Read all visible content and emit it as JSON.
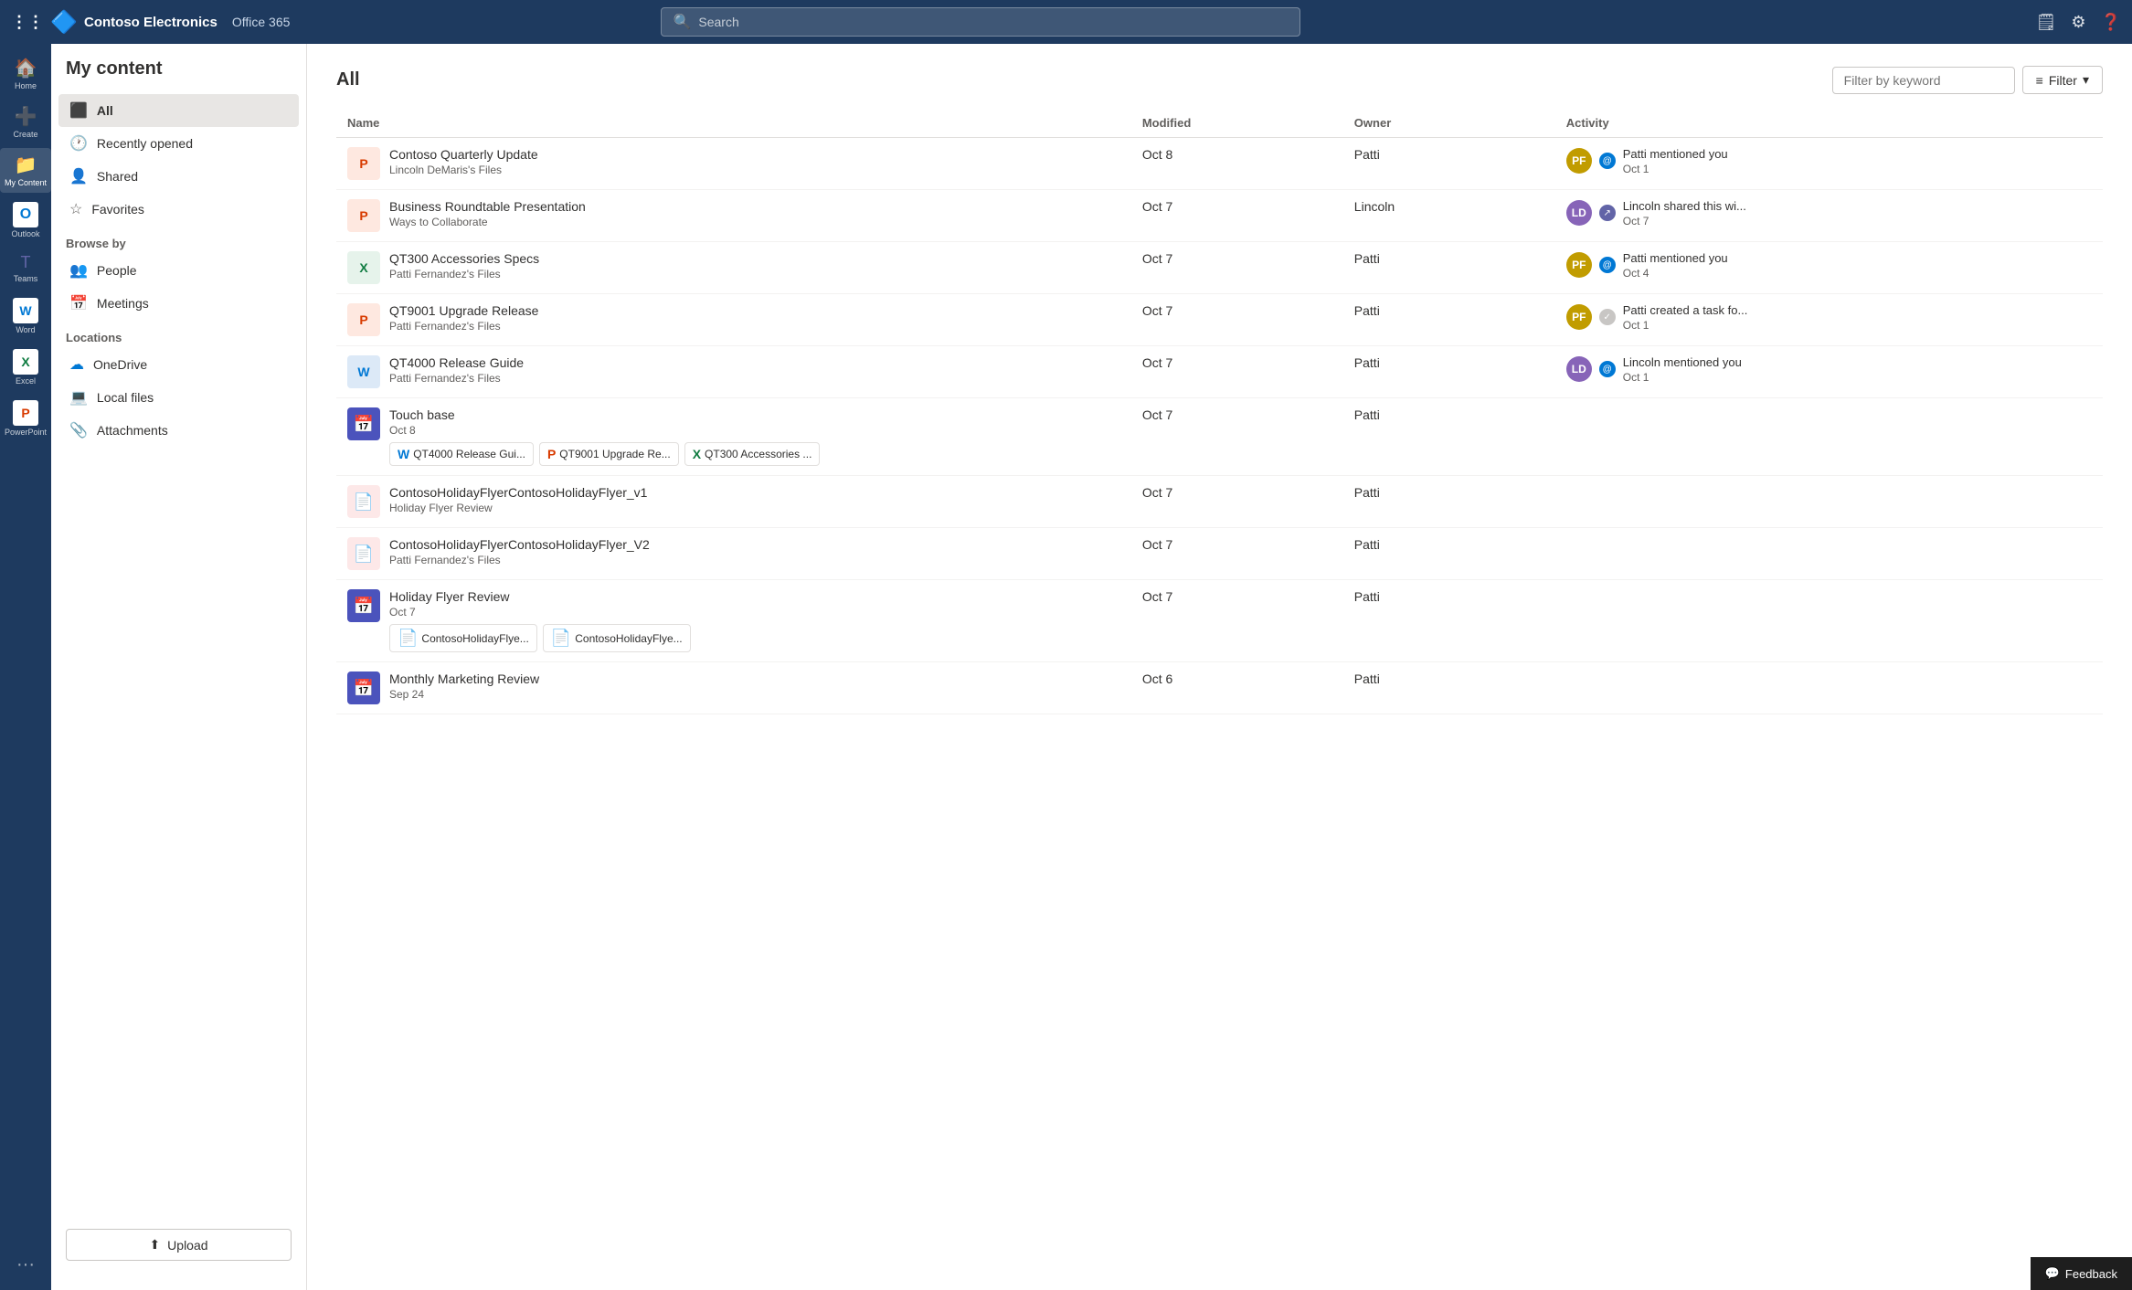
{
  "topnav": {
    "logo_icon": "🔷",
    "company_name": "Contoso Electronics",
    "app_name": "Office 365",
    "search_placeholder": "Search"
  },
  "left_rail": {
    "items": [
      {
        "id": "home",
        "icon": "🏠",
        "label": "Home"
      },
      {
        "id": "create",
        "icon": "➕",
        "label": "Create"
      },
      {
        "id": "mycontent",
        "icon": "📁",
        "label": "My Content",
        "active": true
      },
      {
        "id": "outlook",
        "icon": "📧",
        "label": "Outlook"
      },
      {
        "id": "teams",
        "icon": "👥",
        "label": "Teams"
      },
      {
        "id": "word",
        "icon": "W",
        "label": "Word"
      },
      {
        "id": "excel",
        "icon": "X",
        "label": "Excel"
      },
      {
        "id": "powerpoint",
        "icon": "P",
        "label": "PowerPoint"
      }
    ],
    "more_label": "..."
  },
  "sidebar": {
    "title": "My content",
    "nav_items": [
      {
        "id": "all",
        "icon": "⬛",
        "label": "All",
        "active": true
      },
      {
        "id": "recently-opened",
        "icon": "🕐",
        "label": "Recently opened"
      },
      {
        "id": "shared",
        "icon": "👤",
        "label": "Shared"
      },
      {
        "id": "favorites",
        "icon": "☆",
        "label": "Favorites"
      }
    ],
    "browse_section": "Browse by",
    "browse_items": [
      {
        "id": "people",
        "icon": "👥",
        "label": "People"
      },
      {
        "id": "meetings",
        "icon": "📅",
        "label": "Meetings"
      }
    ],
    "locations_section": "Locations",
    "locations": [
      {
        "id": "onedrive",
        "icon": "☁",
        "label": "OneDrive"
      },
      {
        "id": "local-files",
        "icon": "💻",
        "label": "Local files"
      },
      {
        "id": "attachments",
        "icon": "📎",
        "label": "Attachments"
      }
    ],
    "upload_label": "Upload",
    "upload_icon": "⬆"
  },
  "content": {
    "title": "All",
    "filter_placeholder": "Filter by keyword",
    "filter_label": "Filter",
    "columns": {
      "name": "Name",
      "modified": "Modified",
      "owner": "Owner",
      "activity": "Activity"
    },
    "files": [
      {
        "id": 1,
        "icon_type": "ppt",
        "icon_char": "P",
        "name": "Contoso Quarterly Update",
        "subtitle": "Lincoln DeMaris's Files",
        "modified": "Oct 8",
        "owner": "Patti",
        "activity_user": "Patti",
        "activity_avatar_class": "av-patti",
        "activity_badge_type": "mention",
        "activity_text": "Patti mentioned you",
        "activity_time": "Oct 1"
      },
      {
        "id": 2,
        "icon_type": "ppt",
        "icon_char": "P",
        "name": "Business Roundtable Presentation",
        "subtitle": "Ways to Collaborate",
        "modified": "Oct 7",
        "owner": "Lincoln",
        "activity_user": "Lincoln",
        "activity_avatar_class": "av-lincoln",
        "activity_badge_type": "share",
        "activity_text": "Lincoln shared this wi...",
        "activity_time": "Oct 7"
      },
      {
        "id": 3,
        "icon_type": "xlsx",
        "icon_char": "X",
        "name": "QT300 Accessories Specs",
        "subtitle": "Patti Fernandez's Files",
        "modified": "Oct 7",
        "owner": "Patti",
        "activity_user": "Patti",
        "activity_avatar_class": "av-patti",
        "activity_badge_type": "mention",
        "activity_text": "Patti mentioned you",
        "activity_time": "Oct 4"
      },
      {
        "id": 4,
        "icon_type": "ppt",
        "icon_char": "P",
        "name": "QT9001 Upgrade Release",
        "subtitle": "Patti Fernandez's Files",
        "modified": "Oct 7",
        "owner": "Patti",
        "activity_user": "Patti",
        "activity_avatar_class": "av-patti",
        "activity_badge_type": "task",
        "activity_text": "Patti created a task fo...",
        "activity_time": "Oct 1"
      },
      {
        "id": 5,
        "icon_type": "word",
        "icon_char": "W",
        "name": "QT4000 Release Guide",
        "subtitle": "Patti Fernandez's Files",
        "modified": "Oct 7",
        "owner": "Patti",
        "activity_user": "Lincoln",
        "activity_avatar_class": "av-lincoln",
        "activity_badge_type": "mention",
        "activity_text": "Lincoln mentioned you",
        "activity_time": "Oct 1"
      },
      {
        "id": 6,
        "icon_type": "meeting",
        "icon_char": "📅",
        "name": "Touch base",
        "subtitle": "Oct 8",
        "modified": "Oct 7",
        "owner": "Patti",
        "activity_user": null,
        "activity_text": null,
        "activity_time": null,
        "related_files": [
          {
            "icon_type": "word",
            "label": "QT4000 Release Gui..."
          },
          {
            "icon_type": "ppt",
            "label": "QT9001 Upgrade Re..."
          },
          {
            "icon_type": "xlsx",
            "label": "QT300 Accessories ..."
          }
        ]
      },
      {
        "id": 7,
        "icon_type": "pdf",
        "icon_char": "📄",
        "name": "ContosoHolidayFlyerContosoHolidayFlyer_v1",
        "subtitle": "Holiday Flyer Review",
        "modified": "Oct 7",
        "owner": "Patti",
        "activity_user": null,
        "activity_text": null,
        "activity_time": null
      },
      {
        "id": 8,
        "icon_type": "pdf",
        "icon_char": "📄",
        "name": "ContosoHolidayFlyerContosoHolidayFlyer_V2",
        "subtitle": "Patti Fernandez's Files",
        "modified": "Oct 7",
        "owner": "Patti",
        "activity_user": null,
        "activity_text": null,
        "activity_time": null
      },
      {
        "id": 9,
        "icon_type": "meeting",
        "icon_char": "📅",
        "name": "Holiday Flyer Review",
        "subtitle": "Oct 7",
        "modified": "Oct 7",
        "owner": "Patti",
        "activity_user": null,
        "activity_text": null,
        "activity_time": null,
        "related_files": [
          {
            "icon_type": "pdf",
            "label": "ContosoHolidayFlye..."
          },
          {
            "icon_type": "pdf",
            "label": "ContosoHolidayFlye..."
          }
        ]
      },
      {
        "id": 10,
        "icon_type": "meeting",
        "icon_char": "📅",
        "name": "Monthly Marketing Review",
        "subtitle": "Sep 24",
        "modified": "Oct 6",
        "owner": "Patti",
        "activity_user": null,
        "activity_text": null,
        "activity_time": null
      }
    ]
  },
  "feedback": {
    "label": "Feedback",
    "icon": "💬"
  }
}
